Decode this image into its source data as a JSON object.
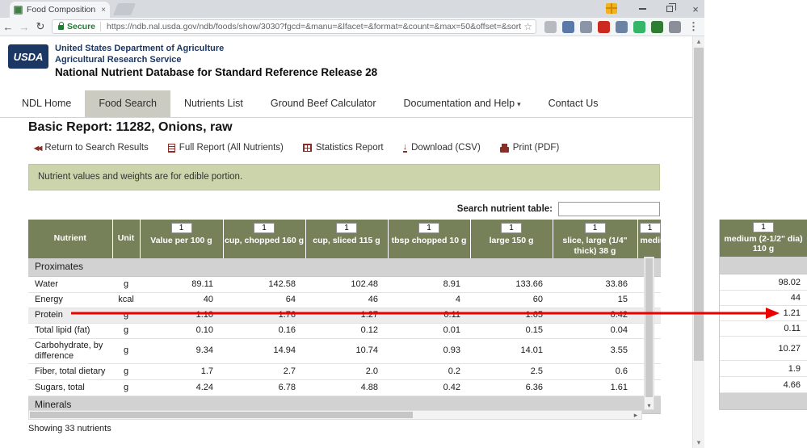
{
  "browser": {
    "tab_title": "Food Composition Datab...",
    "secure_label": "Secure",
    "url": "https://ndb.nal.usda.gov/ndb/foods/show/3030?fgcd=&manu=&lfacet=&format=&count=&max=50&offset=&sort=defaul..."
  },
  "icons": {
    "back": "←",
    "forward": "→",
    "reload": "↻",
    "star": "☆",
    "menu": "⋮",
    "close": "×",
    "caret": "▾",
    "return_arrows": "◀◀",
    "download_arrow": "↓",
    "up": "▴",
    "down": "▾",
    "right": "▸"
  },
  "usda": {
    "logo_text": "USDA",
    "dept": "United States Department of Agriculture",
    "service": "Agricultural Research Service",
    "database": "National Nutrient Database for Standard Reference Release 28"
  },
  "nav": {
    "items": [
      {
        "label": "NDL Home"
      },
      {
        "label": "Food Search"
      },
      {
        "label": "Nutrients List"
      },
      {
        "label": "Ground Beef Calculator"
      },
      {
        "label": "Documentation and Help"
      },
      {
        "label": "Contact Us"
      }
    ]
  },
  "report": {
    "title": "Basic Report:  11282, Onions, raw",
    "actions": {
      "return": "Return to Search Results",
      "full": "Full Report (All Nutrients)",
      "stats": "Statistics Report",
      "download": "Download (CSV)",
      "print": "Print (PDF)"
    },
    "notice": "Nutrient values and weights are for edible portion.",
    "search_label": "Search nutrient table:",
    "showing": "Showing 33 nutrients"
  },
  "table": {
    "input_value": "1",
    "headers": {
      "nutrient": "Nutrient",
      "unit": "Unit",
      "cols": [
        "Value per 100 g",
        "cup, chopped 160 g",
        "cup, sliced 115 g",
        "tbsp chopped 10 g",
        "large 150 g",
        "slice, large (1/4\" thick) 38 g",
        "medium (2-1/2\" dia) 110 g"
      ]
    },
    "section1": "Proximates",
    "section2": "Minerals",
    "rows": [
      {
        "name": "Water",
        "unit": "g",
        "v": [
          "89.11",
          "142.58",
          "102.48",
          "8.91",
          "133.66",
          "33.86"
        ],
        "medium": "98.02"
      },
      {
        "name": "Energy",
        "unit": "kcal",
        "v": [
          "40",
          "64",
          "46",
          "4",
          "60",
          "15"
        ],
        "medium": "44"
      },
      {
        "name": "Protein",
        "unit": "g",
        "v": [
          "1.10",
          "1.76",
          "1.27",
          "0.11",
          "1.65",
          "0.42"
        ],
        "medium": "1.21"
      },
      {
        "name": "Total lipid (fat)",
        "unit": "g",
        "v": [
          "0.10",
          "0.16",
          "0.12",
          "0.01",
          "0.15",
          "0.04"
        ],
        "medium": "0.11"
      },
      {
        "name": "Carbohydrate, by difference",
        "unit": "g",
        "v": [
          "9.34",
          "14.94",
          "10.74",
          "0.93",
          "14.01",
          "3.55"
        ],
        "medium": "10.27"
      },
      {
        "name": "Fiber, total dietary",
        "unit": "g",
        "v": [
          "1.7",
          "2.7",
          "2.0",
          "0.2",
          "2.5",
          "0.6"
        ],
        "medium": "1.9"
      },
      {
        "name": "Sugars, total",
        "unit": "g",
        "v": [
          "4.24",
          "6.78",
          "4.88",
          "0.42",
          "6.36",
          "1.61"
        ],
        "medium": "4.66"
      }
    ]
  },
  "side_panel": {
    "header_line1": "medium (2-1/2\" dia)",
    "header_line2": "110 g"
  },
  "colors": {
    "table_header_green": "#76815a",
    "notice_green": "#cbd4ab",
    "accent_maroon": "#8a2e2a",
    "secure_green": "#1e7d32",
    "arrow_red": "#ee0000"
  }
}
